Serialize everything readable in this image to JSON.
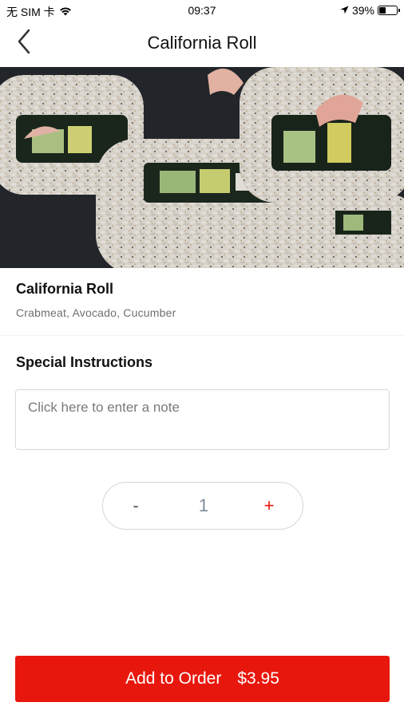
{
  "status_bar": {
    "carrier": "无 SIM 卡",
    "time": "09:37",
    "battery_percent": "39%",
    "battery_level": 0.39
  },
  "nav": {
    "title": "California Roll",
    "back_icon": "chevron-left-icon"
  },
  "hero": {
    "image": "california-roll-photo"
  },
  "item": {
    "name": "California Roll",
    "description": "Crabmeat, Avocado, Cucumber"
  },
  "instructions": {
    "label": "Special Instructions",
    "placeholder": "Click here to enter a note",
    "value": ""
  },
  "stepper": {
    "minus_label": "-",
    "quantity": "1",
    "plus_label": "+"
  },
  "order_button": {
    "label": "Add to Order",
    "price": "$3.95"
  },
  "colors": {
    "accent": "#e8170d",
    "text_primary": "#111111",
    "text_secondary": "#6f6f6f",
    "quantity_text": "#7e8a9a",
    "border": "#d9d9d9"
  }
}
